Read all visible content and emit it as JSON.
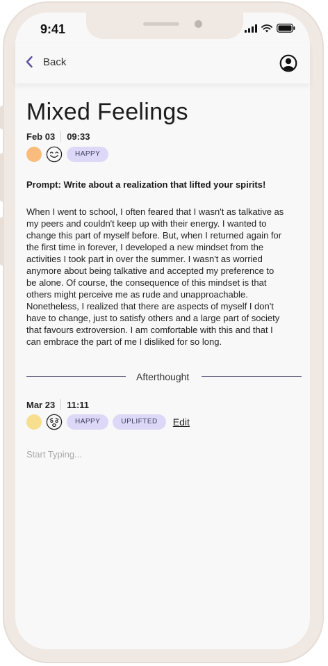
{
  "status_bar": {
    "time": "9:41"
  },
  "nav": {
    "back_label": "Back"
  },
  "entry": {
    "title": "Mixed Feelings",
    "date": "Feb 03",
    "time": "09:33",
    "mood_color": "#f9bc7c",
    "mood_icon": "smiling-face-icon",
    "tags": [
      "HAPPY"
    ],
    "prompt": "Prompt: Write about a realization that lifted your spirits!",
    "lines": [
      "When I went to school, I often feared that I wasn't as talkative as",
      "my peers and couldn't keep up with their energy. I wanted to",
      "change this part of myself before. But, when I returned again for",
      "the first time in forever, I developed a new mindset from the",
      "activities I took part in over the summer. I wasn't as worried",
      "anymore about being talkative and accepted my preference to",
      "be alone. Of course, the consequence of this mindset is that",
      "others might perceive me as rude and unapproachable.",
      "Nonetheless, I realized that there are aspects of myself I don't",
      "have to change, just to satisfy others and a large part of society",
      "that favours extroversion. I am comfortable with this and that I",
      "can embrace the part of me I disliked for so long."
    ]
  },
  "afterthought": {
    "label": "Afterthought",
    "date": "Mar 23",
    "time": "11:11",
    "mood_color": "#f8de8f",
    "mood_icon": "worried-face-icon",
    "tags": [
      "HAPPY",
      "UPLIFTED"
    ],
    "edit_label": "Edit",
    "placeholder": "Start Typing..."
  },
  "colors": {
    "accent": "#5b4fa0",
    "tag_bg": "#ddd8f7"
  }
}
